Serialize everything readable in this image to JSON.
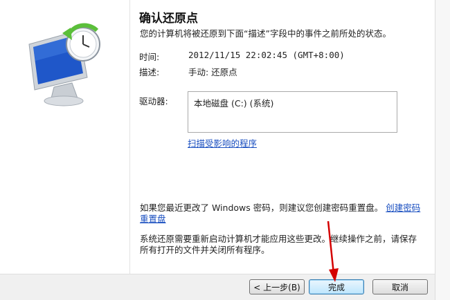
{
  "dialog": {
    "title": "确认还原点",
    "description": "您的计算机将被还原到下面“描述”字段中的事件之前所处的状态。",
    "time_label": "时间:",
    "time_value": "2012/11/15 22:02:45 (GMT+8:00)",
    "desc_label": "描述:",
    "desc_value": "手动: 还原点",
    "drives_label": "驱动器:",
    "drives": [
      "本地磁盘 (C:) (系统)"
    ],
    "scan_link": "扫描受影响的程序",
    "password_notice": "如果您最近更改了 Windows 密码，则建议您创建密码重置盘。",
    "password_link": "创建密码重置盘",
    "restart_notice": "系统还原需要重新启动计算机才能应用这些更改。继续操作之前，请保存所有打开的文件并关闭所有程序。"
  },
  "buttons": {
    "back": "< 上一步(B)",
    "finish": "完成",
    "cancel": "取消"
  },
  "icons": {
    "illustration": "system-restore-monitor-clock-icon",
    "annotation": "red-arrow"
  },
  "colors": {
    "link": "#1a4fc0",
    "annotation_arrow": "#d40000",
    "clock_arrow": "#5bbf3a",
    "screen_blue": "#1f57c9"
  }
}
